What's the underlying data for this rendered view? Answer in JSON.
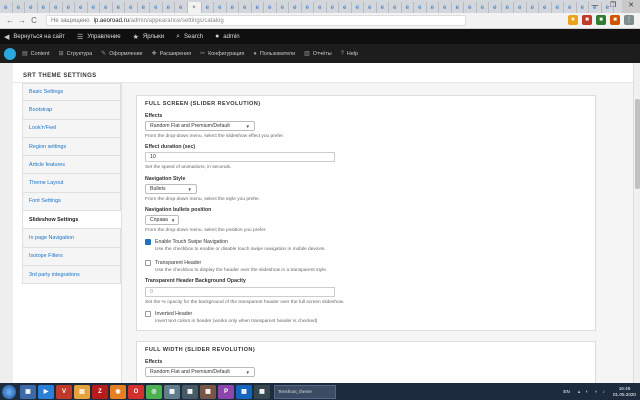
{
  "browser": {
    "tabs_count": 49,
    "active_tab_close": "×",
    "window_controls": [
      "—",
      "❐",
      "✕"
    ],
    "nav": {
      "back": "←",
      "forward": "→",
      "reload": "C"
    },
    "address": {
      "insecure_label": "Не защищено",
      "host": "lp.aeoroad.ru",
      "path": "/admin/appearance/settings/catalog"
    }
  },
  "toolbar": {
    "back_to_site": "Вернуться на сайт",
    "manage": "Управление",
    "shortcuts": "Ярлыки",
    "search": "Search",
    "user": "admin"
  },
  "admin_menu": [
    "Content",
    "Структура",
    "Оформление",
    "Расширения",
    "Конфигурация",
    "Пользователи",
    "Отчёты",
    "Help"
  ],
  "page": {
    "title": "SRT THEME SETTINGS"
  },
  "sidebar": {
    "items": [
      {
        "label": "Basic Settings"
      },
      {
        "label": "Bootstrap"
      },
      {
        "label": "Look'n'Feel"
      },
      {
        "label": "Region settings"
      },
      {
        "label": "Article features"
      },
      {
        "label": "Theme Layout"
      },
      {
        "label": "Font Settings"
      },
      {
        "label": "Slideshow Settings"
      },
      {
        "label": "In page Navigation"
      },
      {
        "label": "Isotope Filters"
      },
      {
        "label": "3rd party integrations"
      }
    ],
    "active_index": 7
  },
  "fullscreen": {
    "legend": "FULL SCREEN (SLIDER REVOLUTION)",
    "effects_label": "Effects",
    "effects_value": "Random Flat and Premium/Default",
    "effects_desc": "From the drop-down menu, select the slideshow effect you prefer.",
    "duration_label": "Effect duration (sec)",
    "duration_value": "10",
    "duration_desc": "Set the speed of animations, in seconds.",
    "navstyle_label": "Navigation Style",
    "navstyle_value": "Bullets",
    "navstyle_desc": "From the drop-down menu, select the style you prefer.",
    "bulletpos_label": "Navigation bullets position",
    "bulletpos_value": "Справа",
    "bulletpos_desc": "From the drop-down menu, select the position you prefer.",
    "touch_label": "Enable Touch Swipe Navigation",
    "touch_checked": true,
    "touch_desc": "Use the checkbox to enable or disable touch swipe navigation in mobile devices.",
    "transparent_label": "Transparent Header",
    "transparent_checked": false,
    "transparent_desc": "Use the checkbox to display the header over the slideshow in a transparent style.",
    "opacity_label": "Transparent Header Background Opacity",
    "opacity_value": "0",
    "opacity_desc": "Set the % opacity for the background of the transparent header over the full screen slideshow.",
    "inverted_label": "Inverted Header",
    "inverted_checked": false,
    "inverted_desc": "Invert text colors in header (works only when transparent header is checked)"
  },
  "fullwidth": {
    "legend": "FULL WIDTH (SLIDER REVOLUTION)",
    "effects_label": "Effects",
    "effects_value": "Random Flat and Premium/Default"
  },
  "taskbar": {
    "task_label": "Tenshoot_theme",
    "lang": "EN",
    "time": "16:49",
    "date": "01.05.2020"
  },
  "colors": {
    "accent": "#1e73be",
    "toolbar": "#0f0f0f",
    "taskbar": "#1c2b3e"
  }
}
